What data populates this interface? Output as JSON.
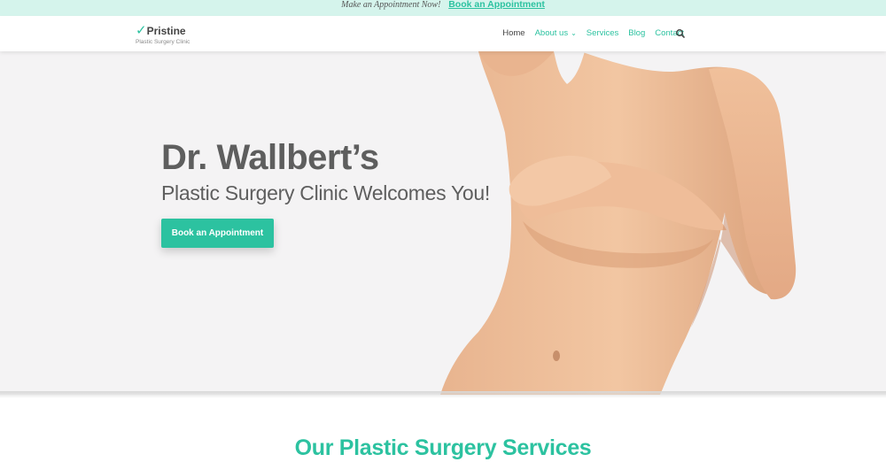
{
  "topbar": {
    "message": "Make an Appointment Now!",
    "link": "Book an Appointment"
  },
  "header": {
    "logo_mark": "✓",
    "logo_name": "Pristine",
    "logo_tagline": "Plastic Surgery Clinic",
    "nav": {
      "home": "Home",
      "about": "About us",
      "about_chevron": "⌄",
      "services": "Services",
      "blog": "Blog",
      "contact": "Contact"
    },
    "search_icon": "search-icon"
  },
  "hero": {
    "title": "Dr. Wallbert’s",
    "subtitle": "Plastic Surgery Clinic Welcomes You!",
    "button": "Book an Appointment"
  },
  "services": {
    "title": "Our Plastic Surgery Services"
  },
  "colors": {
    "accent": "#2cc2a0",
    "topbar_bg": "#d5f4ec",
    "hero_bg": "#f4f3f4",
    "heading_text": "#5e5e5e"
  }
}
